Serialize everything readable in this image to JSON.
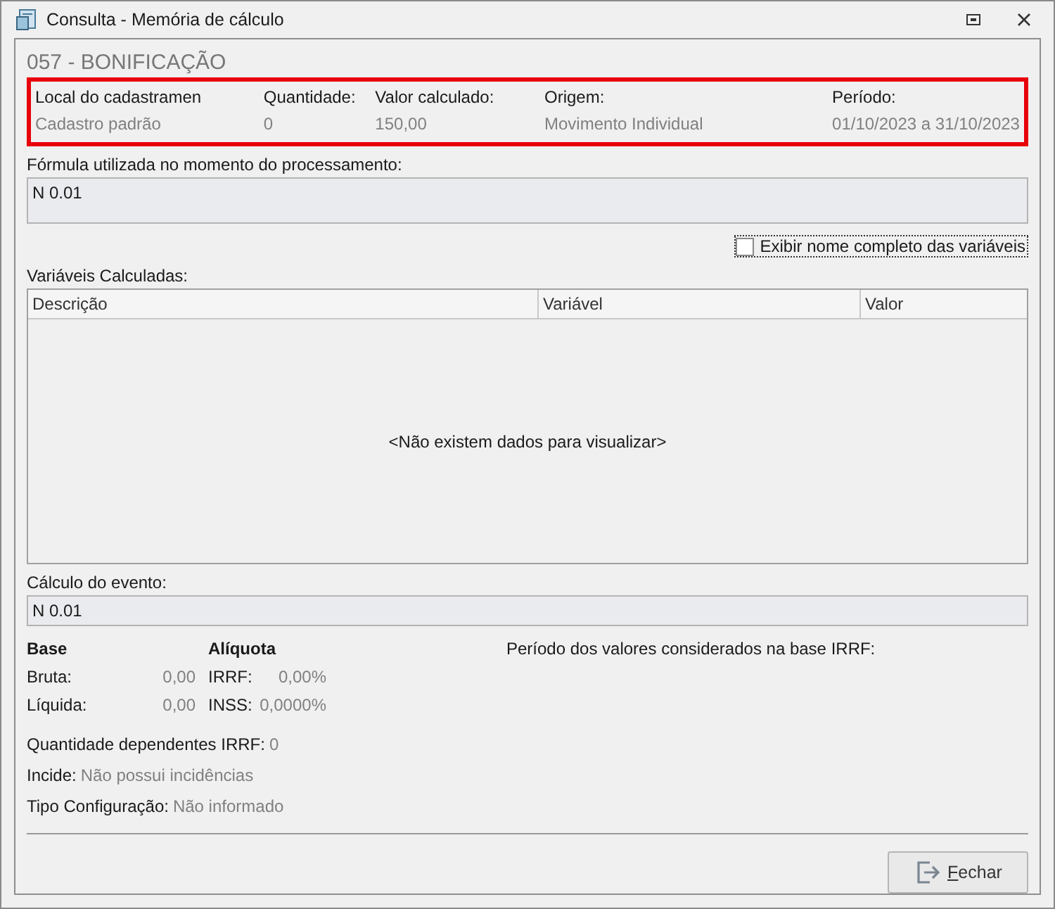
{
  "window": {
    "title": "Consulta - Memória de cálculo"
  },
  "event_title": "057 - BONIFICAÇÃO",
  "summary": [
    {
      "label": "Local do cadastramen",
      "value": "Cadastro padrão"
    },
    {
      "label": "Quantidade:",
      "value": "0"
    },
    {
      "label": "Valor calculado:",
      "value": "150,00"
    },
    {
      "label": "Origem:",
      "value": "Movimento Individual"
    },
    {
      "label": "Período:",
      "value": "01/10/2023 a 31/10/2023"
    }
  ],
  "formula": {
    "label": "Fórmula utilizada no momento do processamento:",
    "value": "N 0.01"
  },
  "full_names_checkbox": {
    "label": "Exibir nome completo das variáveis",
    "checked": false
  },
  "variables": {
    "label": "Variáveis Calculadas:",
    "columns": [
      "Descrição",
      "Variável",
      "Valor"
    ],
    "empty_text": "<Não existem dados para visualizar>"
  },
  "event_calc": {
    "label": "Cálculo do evento:",
    "value": "N 0.01"
  },
  "base": {
    "heading": "Base",
    "rows": [
      {
        "label": "Bruta:",
        "value": "0,00"
      },
      {
        "label": "Líquida:",
        "value": "0,00"
      }
    ]
  },
  "rate": {
    "heading": "Alíquota",
    "rows": [
      {
        "label": "IRRF:",
        "value": "0,00%"
      },
      {
        "label": "INSS:",
        "value": "0,0000%"
      }
    ]
  },
  "irrf_period_label": "Período dos valores considerados na base IRRF:",
  "details": [
    {
      "label": "Quantidade dependentes IRRF:",
      "value": "0"
    },
    {
      "label": "Incide:",
      "value": "Não possui incidências"
    },
    {
      "label": "Tipo Configuração:",
      "value": "Não informado"
    }
  ],
  "close_button": {
    "label": "Fechar"
  }
}
